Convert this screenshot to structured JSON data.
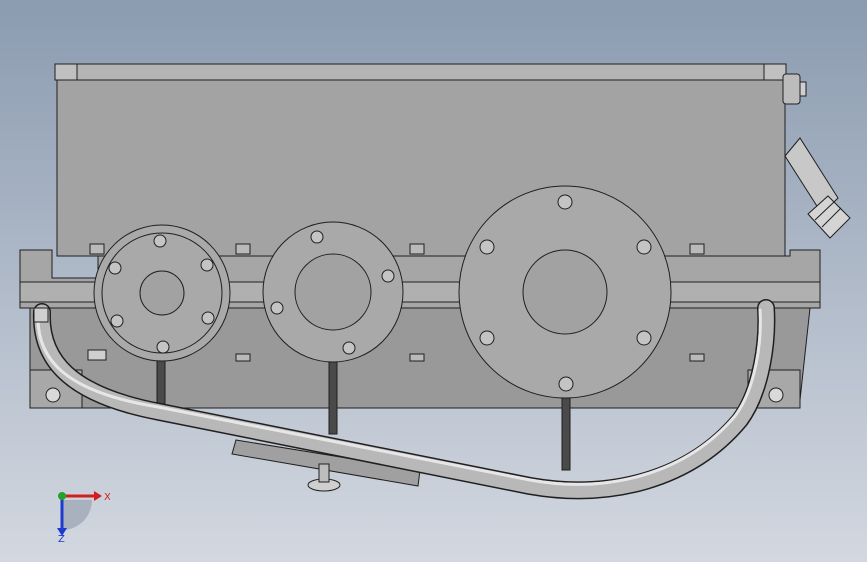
{
  "colors": {
    "background_top": "#8b9bb0",
    "background_bottom": "#d3d8e0",
    "housing": "#a3a3a3",
    "housing_dark": "#8e8e8e",
    "outline": "#1f1f1f",
    "pipe": "#b8b8b8",
    "pipe_highlight": "#e6e6e6",
    "axis_x": "#d11f1f",
    "axis_y": "#25a12b",
    "axis_z": "#1f3ad1"
  },
  "triad": {
    "x_label": "X",
    "z_label": "Z"
  }
}
